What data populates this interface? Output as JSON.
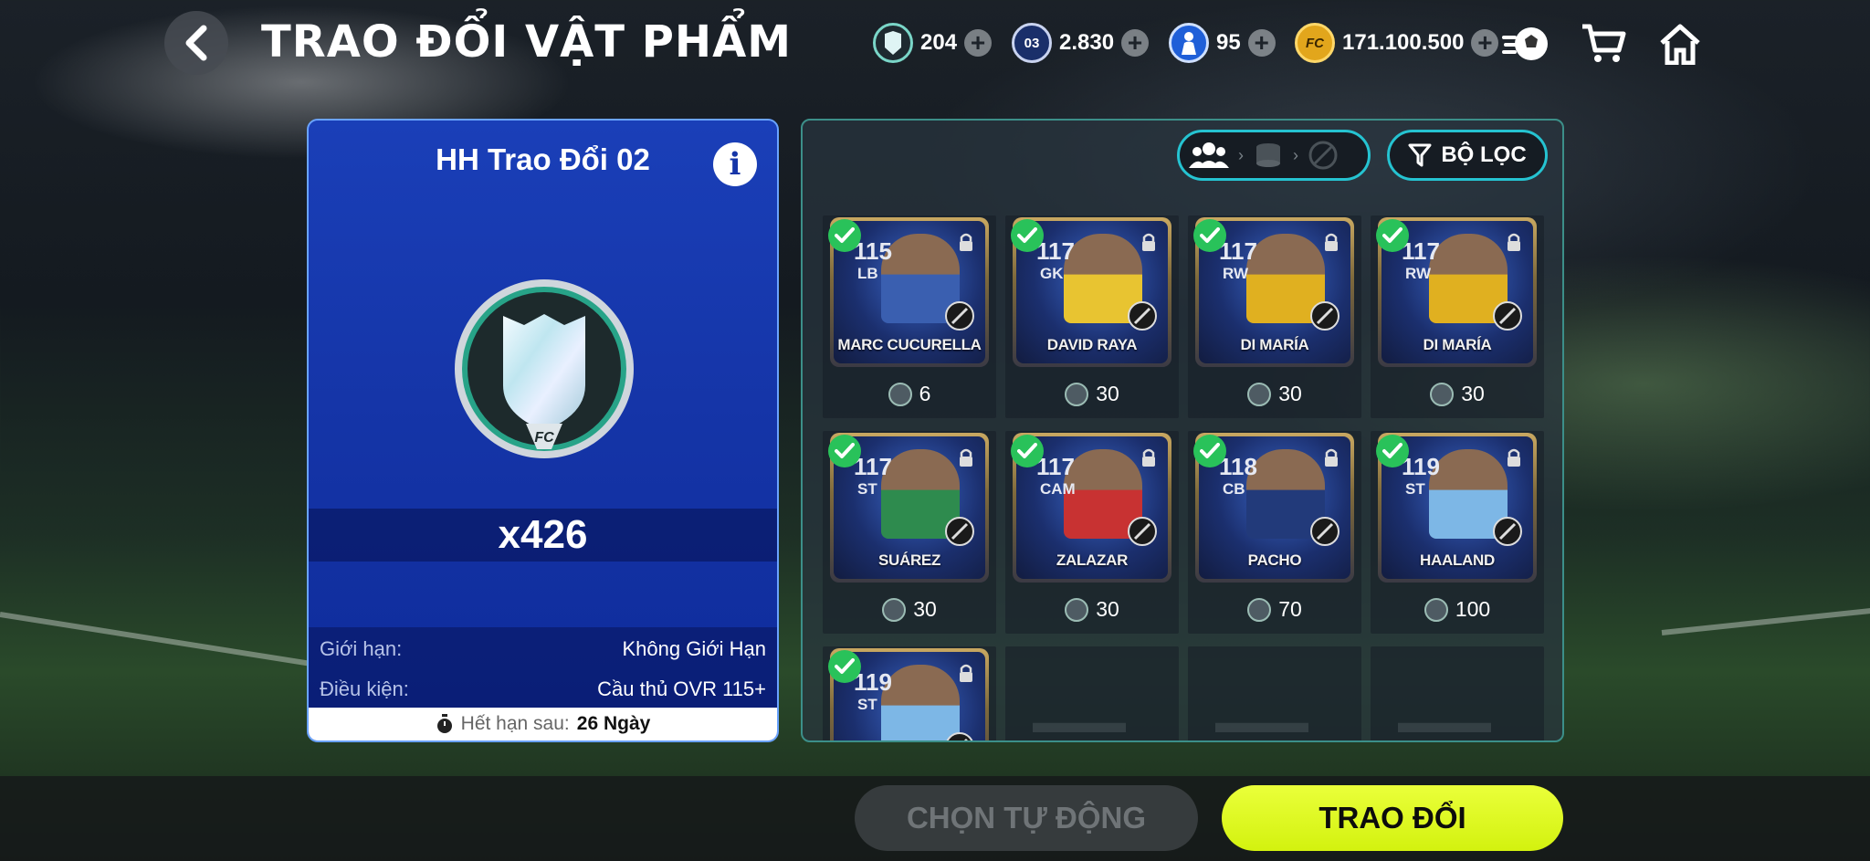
{
  "header": {
    "title": "TRAO ĐỔI VẬT PHẨM",
    "currencies": [
      {
        "value": "204",
        "icon": "shield-token-icon",
        "badge": ""
      },
      {
        "value": "2.830",
        "icon": "card-pack-icon",
        "badge": "03"
      },
      {
        "value": "95",
        "icon": "player-coin-icon",
        "badge": ""
      },
      {
        "value": "171.100.500",
        "icon": "fc-coin-icon",
        "badge": "FC"
      }
    ]
  },
  "exchange_item": {
    "title": "HH Trao Đổi 02",
    "quantity": "x426",
    "limit_label": "Giới hạn:",
    "limit_value": "Không Giới Hạn",
    "condition_label": "Điều kiện:",
    "condition_value": "Cầu thủ OVR 115+",
    "expiry_label": "Hết hạn sau:",
    "expiry_value": "26 Ngày"
  },
  "filter": {
    "label": "BỘ LỌC"
  },
  "players": [
    {
      "ovr": "115",
      "pos": "LB",
      "name": "MARC CUCURELLA",
      "cost": "6",
      "color": "#3a5fb0"
    },
    {
      "ovr": "117",
      "pos": "GK",
      "name": "DAVID RAYA",
      "cost": "30",
      "color": "#e8c431"
    },
    {
      "ovr": "117",
      "pos": "RW",
      "name": "DI MARÍA",
      "cost": "30",
      "color": "#e0b020"
    },
    {
      "ovr": "117",
      "pos": "RW",
      "name": "DI MARÍA",
      "cost": "30",
      "color": "#e0b020"
    },
    {
      "ovr": "117",
      "pos": "ST",
      "name": "SUÁREZ",
      "cost": "30",
      "color": "#2e8b4e"
    },
    {
      "ovr": "117",
      "pos": "CAM",
      "name": "ZALAZAR",
      "cost": "30",
      "color": "#c83232"
    },
    {
      "ovr": "118",
      "pos": "CB",
      "name": "PACHO",
      "cost": "70",
      "color": "#223a7a"
    },
    {
      "ovr": "119",
      "pos": "ST",
      "name": "HAALAND",
      "cost": "100",
      "color": "#7db7e6"
    },
    {
      "ovr": "119",
      "pos": "ST",
      "name": "",
      "cost": "",
      "color": "#7db7e6"
    }
  ],
  "actions": {
    "auto_select": "CHỌN TỰ ĐỘNG",
    "trade": "TRAO ĐỔI"
  }
}
